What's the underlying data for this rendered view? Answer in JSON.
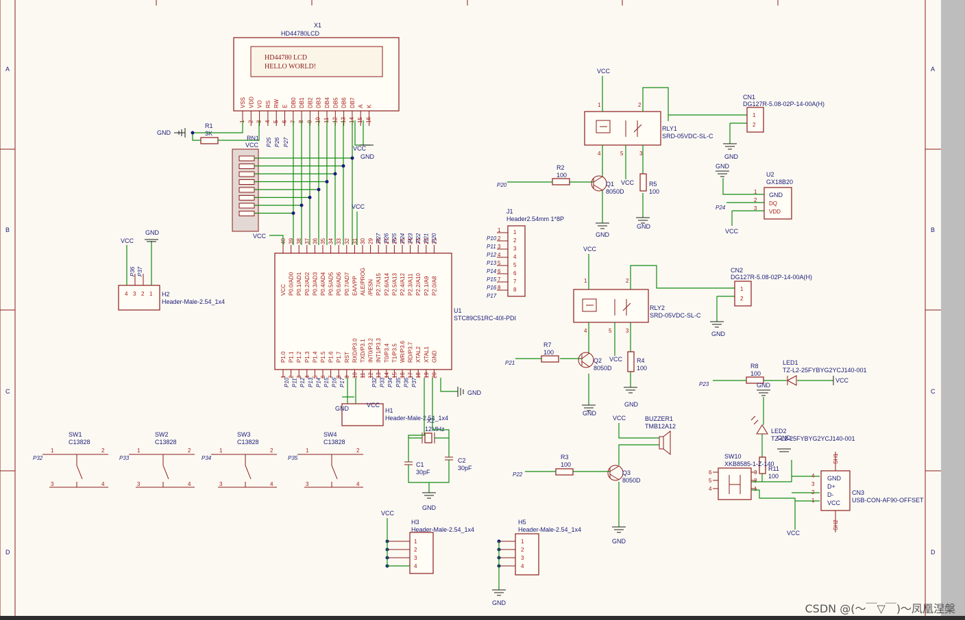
{
  "grid": {
    "row_labels": [
      "A",
      "B",
      "C",
      "D"
    ],
    "col_lines": 6
  },
  "lcd": {
    "ref": "X1",
    "part": "HD44780LCD",
    "screen_line1": "HD44780 LCD",
    "screen_line2": "HELLO WORLD!",
    "pin_names": [
      "VSS",
      "VDD",
      "VO",
      "RS",
      "RW",
      "E",
      "DB0",
      "DB1",
      "DB2",
      "DB3",
      "DB4",
      "DB5",
      "DB6",
      "DB7",
      "A",
      "K"
    ],
    "pin_numbers": [
      "1",
      "2",
      "3",
      "4",
      "5",
      "6",
      "7",
      "8",
      "9",
      "10",
      "11",
      "12",
      "13",
      "14",
      "15",
      "16"
    ],
    "nets": [
      "P25",
      "P26",
      "P27"
    ]
  },
  "mcu": {
    "ref": "U1",
    "part": "STC89C51RC-40I-PDI",
    "top_pins": [
      {
        "n": "40",
        "name": "VCC"
      },
      {
        "n": "39",
        "name": "P0.0/AD0"
      },
      {
        "n": "38",
        "name": "P0.1/AD1"
      },
      {
        "n": "37",
        "name": "P0.2/AD2"
      },
      {
        "n": "36",
        "name": "P0.3/AD3"
      },
      {
        "n": "35",
        "name": "P0.4/AD4"
      },
      {
        "n": "34",
        "name": "P0.5/AD5"
      },
      {
        "n": "33",
        "name": "P0.6/AD6"
      },
      {
        "n": "32",
        "name": "P0.7/AD7"
      },
      {
        "n": "31",
        "name": "EA/VPP"
      },
      {
        "n": "30",
        "name": "ALE/PROG"
      },
      {
        "n": "29",
        "name": "/PESN"
      },
      {
        "n": "28",
        "name": "P2.7/A15"
      },
      {
        "n": "27",
        "name": "P2.6/A14"
      },
      {
        "n": "26",
        "name": "P2.5/A13"
      },
      {
        "n": "25",
        "name": "P2.4/A12"
      },
      {
        "n": "24",
        "name": "P2.3/A11"
      },
      {
        "n": "23",
        "name": "P2.2/A10"
      },
      {
        "n": "22",
        "name": "P2.1/A9"
      },
      {
        "n": "21",
        "name": "P2.0/A8"
      }
    ],
    "bottom_pins": [
      {
        "n": "1",
        "name": "P1.0"
      },
      {
        "n": "2",
        "name": "P1.1"
      },
      {
        "n": "3",
        "name": "P1.2"
      },
      {
        "n": "4",
        "name": "P1.3"
      },
      {
        "n": "5",
        "name": "P1.4"
      },
      {
        "n": "6",
        "name": "P1.5"
      },
      {
        "n": "7",
        "name": "P1.6"
      },
      {
        "n": "8",
        "name": "P1.7"
      },
      {
        "n": "9",
        "name": "RST"
      },
      {
        "n": "10",
        "name": "RXD/P3.0"
      },
      {
        "n": "11",
        "name": "TXD/P3.1"
      },
      {
        "n": "12",
        "name": "INT0/P3.2"
      },
      {
        "n": "13",
        "name": "INT1/P3.3"
      },
      {
        "n": "14",
        "name": "T0/P3.4"
      },
      {
        "n": "15",
        "name": "T1/P3.5"
      },
      {
        "n": "16",
        "name": "WR/P3.6"
      },
      {
        "n": "17",
        "name": "RD/P3.7"
      },
      {
        "n": "18",
        "name": "XTAL2"
      },
      {
        "n": "19",
        "name": "XTAL1"
      },
      {
        "n": "20",
        "name": "GND"
      }
    ],
    "top_nets": [
      "P27",
      "P26",
      "P25",
      "P24",
      "P23",
      "P22",
      "P21",
      "P20"
    ],
    "bottom_nets": [
      "P10",
      "P11",
      "P12",
      "P13",
      "P14",
      "P15",
      "P16",
      "P17"
    ],
    "bottom_nets2": [
      "P32",
      "P33",
      "P34",
      "P35",
      "P36",
      "P37"
    ]
  },
  "rn1": {
    "ref": "RN1"
  },
  "r1": {
    "ref": "R1",
    "value": "3K"
  },
  "j1": {
    "ref": "J1",
    "part": "Header2.54mm 1*8P",
    "pins": [
      "1",
      "2",
      "3",
      "4",
      "5",
      "6",
      "7",
      "8"
    ],
    "nets": [
      "P10",
      "P11",
      "P12",
      "P13",
      "P14",
      "P15",
      "P16",
      "P17"
    ]
  },
  "h1": {
    "ref": "H1",
    "part": "Header-Male-2.54_1x4",
    "pins": [
      "4",
      "3",
      "2",
      "1"
    ]
  },
  "h2": {
    "ref": "H2",
    "part": "Header-Male-2.54_1x4",
    "pins": [
      "4",
      "3",
      "2",
      "1"
    ],
    "nets": [
      "P36",
      "P37"
    ]
  },
  "h3": {
    "ref": "H3",
    "part": "Header-Male-2.54_1x4",
    "pins": [
      "1",
      "2",
      "3",
      "4"
    ]
  },
  "h5": {
    "ref": "H5",
    "part": "Header-Male-2.54_1x4",
    "pins": [
      "1",
      "2",
      "3",
      "4"
    ]
  },
  "crystal": {
    "ref": "X2",
    "value": "12MHz"
  },
  "c1": {
    "ref": "C1",
    "value": "30pF"
  },
  "c2": {
    "ref": "C2",
    "value": "30pF"
  },
  "switches": [
    {
      "ref": "SW1",
      "part": "C13828",
      "net": "P32"
    },
    {
      "ref": "SW2",
      "part": "C13828",
      "net": "P33"
    },
    {
      "ref": "SW3",
      "part": "C13828",
      "net": "P34"
    },
    {
      "ref": "SW4",
      "part": "C13828",
      "net": "P35"
    }
  ],
  "switch_pins": [
    "1",
    "2",
    "3",
    "4"
  ],
  "rly1": {
    "ref": "RLY1",
    "part": "SRD-05VDC-SL-C",
    "pins": [
      "1",
      "2",
      "4",
      "5",
      "3"
    ]
  },
  "rly2": {
    "ref": "RLY2",
    "part": "SRD-05VDC-SL-C",
    "pins": [
      "1",
      "2",
      "4",
      "5",
      "3"
    ]
  },
  "cn1": {
    "ref": "CN1",
    "part": "DG127R-5.08-02P-14-00A(H)",
    "pins": [
      "1",
      "2"
    ]
  },
  "cn2": {
    "ref": "CN2",
    "part": "DG127R-5.08-02P-14-00A(H)",
    "pins": [
      "1",
      "2"
    ]
  },
  "cn3": {
    "ref": "CN3",
    "part": "USB-CON-AF90-OFFSET",
    "pins": [
      {
        "n": "4",
        "name": "GND"
      },
      {
        "n": "3",
        "name": "D+"
      },
      {
        "n": "2",
        "name": "D-"
      },
      {
        "n": "1",
        "name": "VCC"
      }
    ],
    "shields": [
      "SH1",
      "SH2"
    ]
  },
  "q1": {
    "ref": "Q1",
    "part": "8050D"
  },
  "q2": {
    "ref": "Q2",
    "part": "8050D"
  },
  "q3": {
    "ref": "Q3",
    "part": "8050D"
  },
  "r2": {
    "ref": "R2",
    "value": "100",
    "net": "P20"
  },
  "r3": {
    "ref": "R3",
    "value": "100",
    "net": "P22"
  },
  "r4": {
    "ref": "R4",
    "value": "100"
  },
  "r5": {
    "ref": "R5",
    "value": "100"
  },
  "r7": {
    "ref": "R7",
    "value": "100",
    "net": "P21"
  },
  "r8": {
    "ref": "R8",
    "value": "100",
    "net": "P23"
  },
  "r11": {
    "ref": "R11",
    "value": "100"
  },
  "u2": {
    "ref": "U2",
    "part": "GX18B20",
    "pins": [
      {
        "n": "1",
        "name": "GND"
      },
      {
        "n": "2",
        "name": "DQ"
      },
      {
        "n": "3",
        "name": "VDD"
      }
    ],
    "net": "P24"
  },
  "buzzer": {
    "ref": "BUZZER1",
    "part": "TMB12A12"
  },
  "led1": {
    "ref": "LED1",
    "part": "TZ-L2-25FYBYG2YCJ140-001"
  },
  "led2": {
    "ref": "LED2",
    "part": "TZ-L2-25FYBYG2YCJ140-001"
  },
  "sw10": {
    "ref": "SW10",
    "part": "XKB8585-1-Z-140",
    "pins": [
      "6",
      "5",
      "4",
      "3",
      "2",
      "1"
    ]
  },
  "power": {
    "vcc": "VCC",
    "gnd": "GND"
  },
  "watermark": "CSDN @(～￣▽￣)～凤凰涅槃"
}
